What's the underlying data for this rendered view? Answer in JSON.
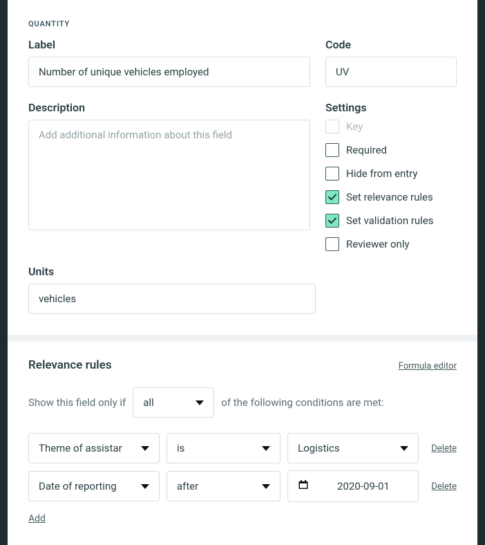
{
  "eyebrow": "QUANTITY",
  "labels": {
    "label": "Label",
    "code": "Code",
    "description": "Description",
    "settings": "Settings",
    "units": "Units"
  },
  "fields": {
    "label_value": "Number of unique vehicles employed",
    "code_value": "UV",
    "description_value": "",
    "description_placeholder": "Add additional information about this field",
    "units_value": "vehicles"
  },
  "settings": [
    {
      "label": "Key",
      "checked": false,
      "disabled": true
    },
    {
      "label": "Required",
      "checked": false,
      "disabled": false
    },
    {
      "label": "Hide from entry",
      "checked": false,
      "disabled": false
    },
    {
      "label": "Set relevance rules",
      "checked": true,
      "disabled": false
    },
    {
      "label": "Set validation rules",
      "checked": true,
      "disabled": false
    },
    {
      "label": "Reviewer only",
      "checked": false,
      "disabled": false
    }
  ],
  "rules": {
    "title": "Relevance rules",
    "formula_editor": "Formula editor",
    "sentence_pre": "Show this field only if",
    "match_mode": "all",
    "sentence_post": "of the following conditions are met:",
    "delete_label": "Delete",
    "add_label": "Add",
    "conditions": [
      {
        "field": "Theme of assistar",
        "op": "is",
        "value": "Logistics",
        "type": "select"
      },
      {
        "field": "Date of reporting",
        "op": "after",
        "value": "2020-09-01",
        "type": "date"
      }
    ]
  }
}
